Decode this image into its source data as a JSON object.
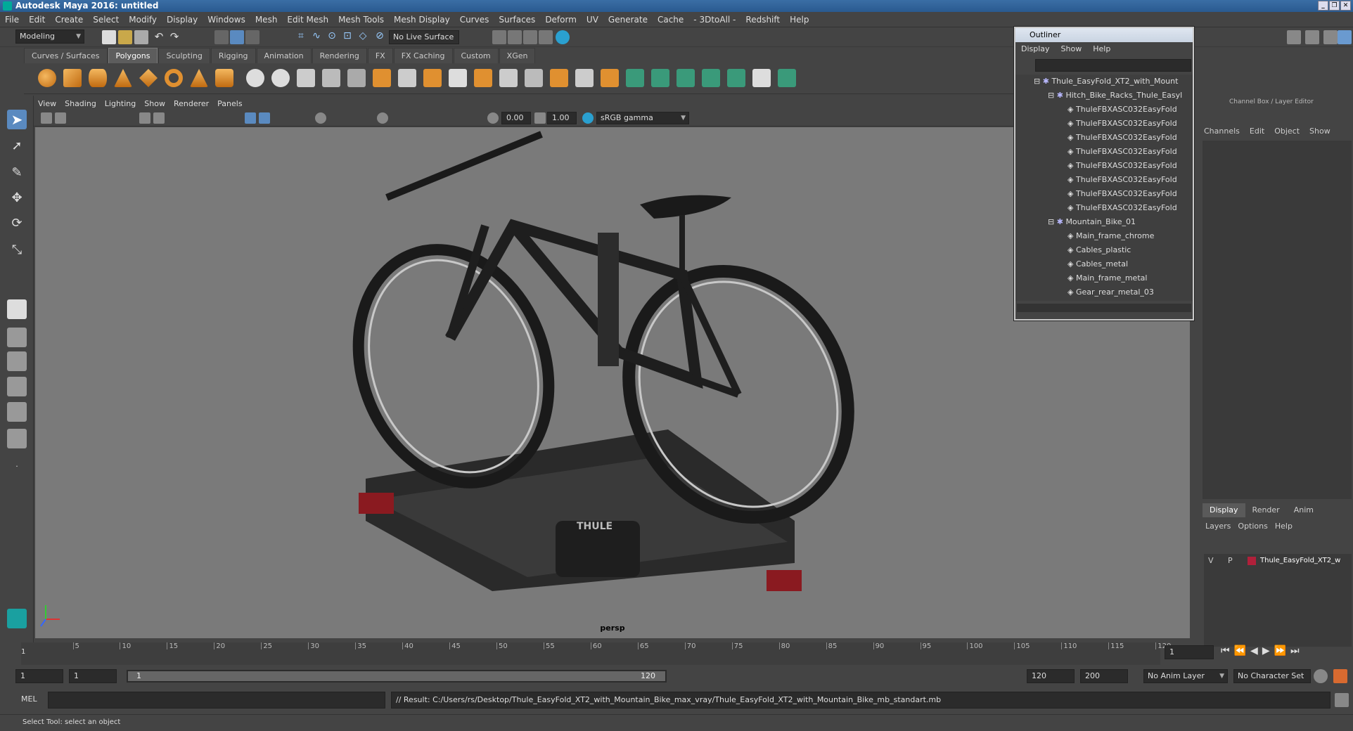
{
  "window": {
    "title": "Autodesk Maya 2016: untitled"
  },
  "menubar": [
    "File",
    "Edit",
    "Create",
    "Select",
    "Modify",
    "Display",
    "Windows",
    "Mesh",
    "Edit Mesh",
    "Mesh Tools",
    "Mesh Display",
    "Curves",
    "Surfaces",
    "Deform",
    "UV",
    "Generate",
    "Cache",
    "- 3DtoAll -",
    "Redshift",
    "Help"
  ],
  "statusline": {
    "mode": "Modeling",
    "live_surface": "No Live Surface"
  },
  "shelf_tabs": [
    "Curves / Surfaces",
    "Polygons",
    "Sculpting",
    "Rigging",
    "Animation",
    "Rendering",
    "FX",
    "FX Caching",
    "Custom",
    "XGen"
  ],
  "shelf_active": "Polygons",
  "viewport": {
    "menu": [
      "View",
      "Shading",
      "Lighting",
      "Show",
      "Renderer",
      "Panels"
    ],
    "exposure": "0.00",
    "gamma": "1.00",
    "color_space": "sRGB gamma",
    "camera_label": "persp",
    "brand_logo_text": "THULE"
  },
  "outliner": {
    "title": "Outliner",
    "menu": [
      "Display",
      "Show",
      "Help"
    ],
    "rows": [
      {
        "label": "Thule_EasyFold_XT2_with_Mount"
      },
      {
        "label": "Hitch_Bike_Racks_Thule_Easyl"
      },
      {
        "label": "ThuleFBXASC032EasyFold"
      },
      {
        "label": "ThuleFBXASC032EasyFold"
      },
      {
        "label": "ThuleFBXASC032EasyFold"
      },
      {
        "label": "ThuleFBXASC032EasyFold"
      },
      {
        "label": "ThuleFBXASC032EasyFold"
      },
      {
        "label": "ThuleFBXASC032EasyFold"
      },
      {
        "label": "ThuleFBXASC032EasyFold"
      },
      {
        "label": "ThuleFBXASC032EasyFold"
      },
      {
        "label": "Mountain_Bike_01"
      },
      {
        "label": "Main_frame_chrome"
      },
      {
        "label": "Cables_plastic"
      },
      {
        "label": "Cables_metal"
      },
      {
        "label": "Main_frame_metal"
      },
      {
        "label": "Gear_rear_metal_03"
      }
    ]
  },
  "channelbox": {
    "title": "Channel Box / Layer Editor",
    "menu": [
      "Channels",
      "Edit",
      "Object",
      "Show"
    ],
    "tabs": [
      "Display",
      "Render",
      "Anim"
    ],
    "layer_menu": [
      "Layers",
      "Options",
      "Help"
    ],
    "layer": {
      "v": "V",
      "p": "P",
      "name": "Thule_EasyFold_XT2_w",
      "color": "#b0203a"
    }
  },
  "timeline": {
    "ticks": [
      "5",
      "10",
      "15",
      "20",
      "25",
      "30",
      "35",
      "40",
      "45",
      "50",
      "55",
      "60",
      "65",
      "70",
      "75",
      "80",
      "85",
      "90",
      "95",
      "100",
      "105",
      "110",
      "115",
      "120"
    ],
    "start_marker": "1",
    "current_frame": "1"
  },
  "range": {
    "start": "1",
    "playback_start": "1",
    "slider_start": "1",
    "slider_end": "120",
    "playback_end": "120",
    "end": "200",
    "anim_layer": "No Anim Layer",
    "char_set": "No Character Set"
  },
  "cmdline": {
    "lang": "MEL",
    "result": "// Result: C:/Users/rs/Desktop/Thule_EasyFold_XT2_with_Mountain_Bike_max_vray/Thule_EasyFold_XT2_with_Mountain_Bike_mb_standart.mb"
  },
  "helpline": "Select Tool: select an object"
}
